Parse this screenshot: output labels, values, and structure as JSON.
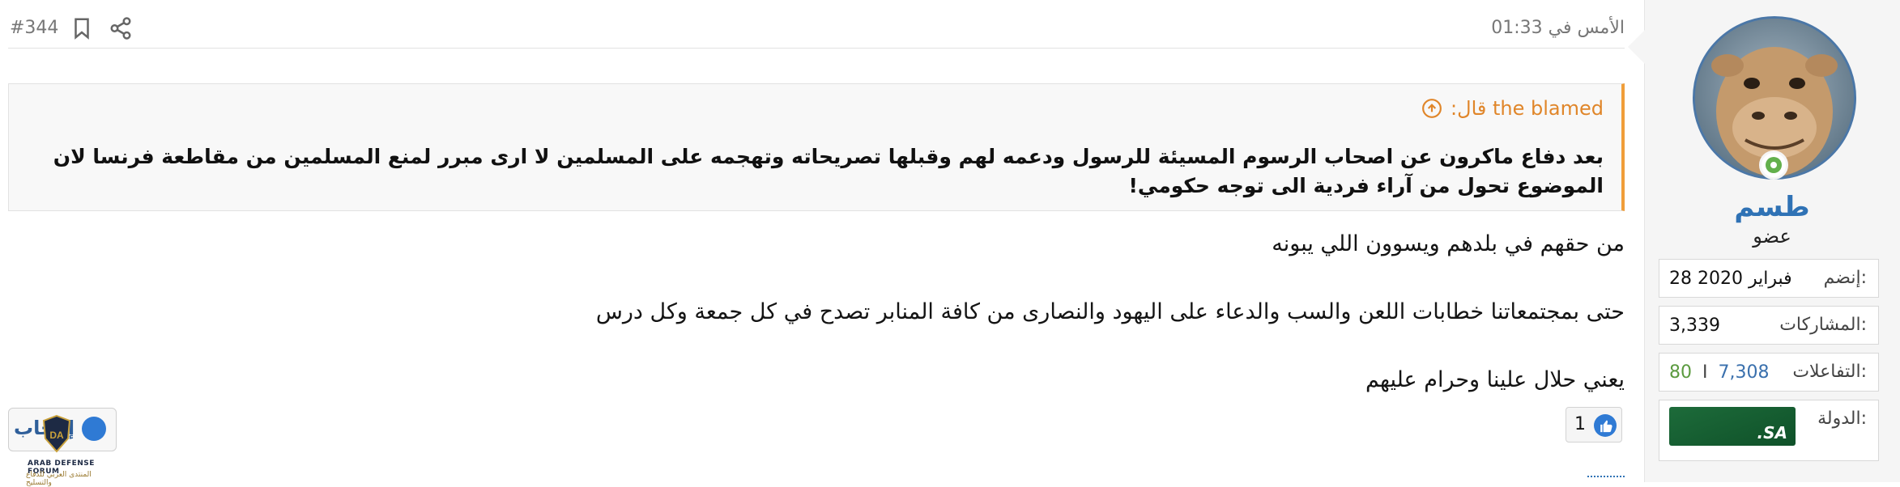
{
  "user": {
    "name": "طسم",
    "title": "عضو",
    "online_icon": "online-indicator-icon",
    "stats": [
      {
        "label": "إنضم:",
        "value": "28 فبراير 2020"
      },
      {
        "label": "المشاركات:",
        "value": "3,339"
      },
      {
        "label": "التفاعلات:",
        "value_blue": "7,308",
        "separator": "I",
        "value_green": "80"
      },
      {
        "label": "الدولة:",
        "flag_text": ".SA"
      }
    ]
  },
  "post": {
    "date": "الأمس في 01:33",
    "number": "#344",
    "quote": {
      "author": "the blamed قال:",
      "text": "بعد دفاع ماكرون عن اصحاب الرسوم المسيئة للرسول ودعمه لهم وقبلها تصريحاته وتهجمه على المسلمين لا ارى مبرر لمنع المسلمين من مقاطعة فرنسا لان الموضوع تحول من آراء فردية الى توجه حكومي!"
    },
    "lines": [
      "من حقهم في بلدهم ويسوون اللي يبونه",
      "حتى بمجتمعاتنا خطابات اللعن والسب والدعاء على اليهود والنصارى من كافة المنابر تصدح في كل جمعة وكل درس",
      "يعني حلال علينا وحرام عليهم"
    ],
    "like_count": "1"
  },
  "logo": {
    "button_text": "إعجاب",
    "name": "ARAB DEFENSE FORUM",
    "arabic": "المنتدى العربي للدفاع والتسليح"
  },
  "colors": {
    "accent": "#2f72b5",
    "quote_border": "#f09e3a",
    "online": "#63b04c",
    "reactions_positive": "#5b9a3f"
  }
}
